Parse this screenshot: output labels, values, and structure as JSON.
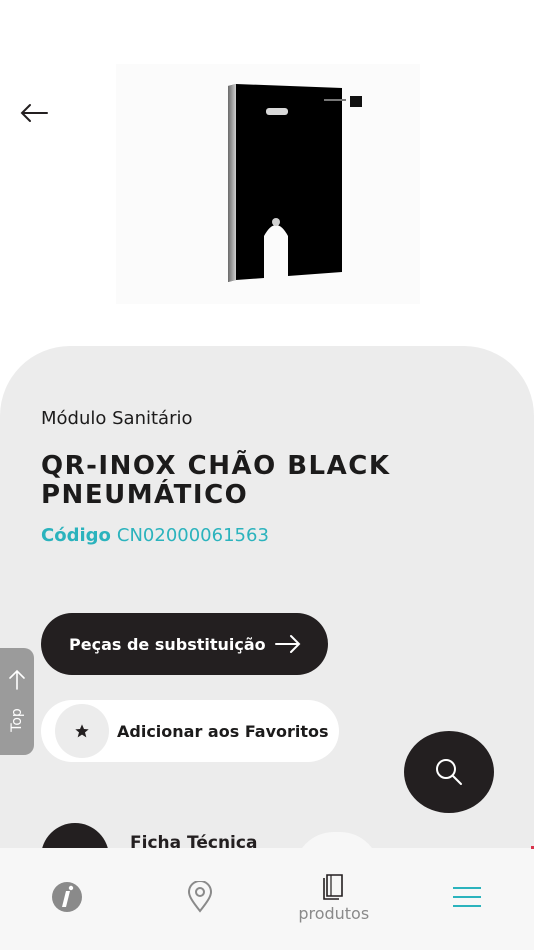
{
  "header": {
    "back_icon": "arrow-left-icon"
  },
  "product": {
    "category": "Módulo Sanitário",
    "title": "QR-INOX CHÃO BLACK PNEUMÁTICO",
    "code_label": "Código",
    "code_value": "CN02000061563"
  },
  "actions": {
    "parts_label": "Peças de substituição",
    "favorites_label": "Adicionar aos Favoritos"
  },
  "side_tab": {
    "label": "Top"
  },
  "peek": {
    "label": "Ficha Técnica"
  },
  "bottom_nav": {
    "items": [
      {
        "icon": "brand-logo-icon",
        "label": ""
      },
      {
        "icon": "location-pin-icon",
        "label": ""
      },
      {
        "icon": "catalog-book-icon",
        "label": "produtos"
      },
      {
        "icon": "hamburger-menu-icon",
        "label": ""
      }
    ]
  },
  "colors": {
    "accent": "#2bb3bd",
    "dark": "#231f20",
    "sheet": "#ececec"
  }
}
